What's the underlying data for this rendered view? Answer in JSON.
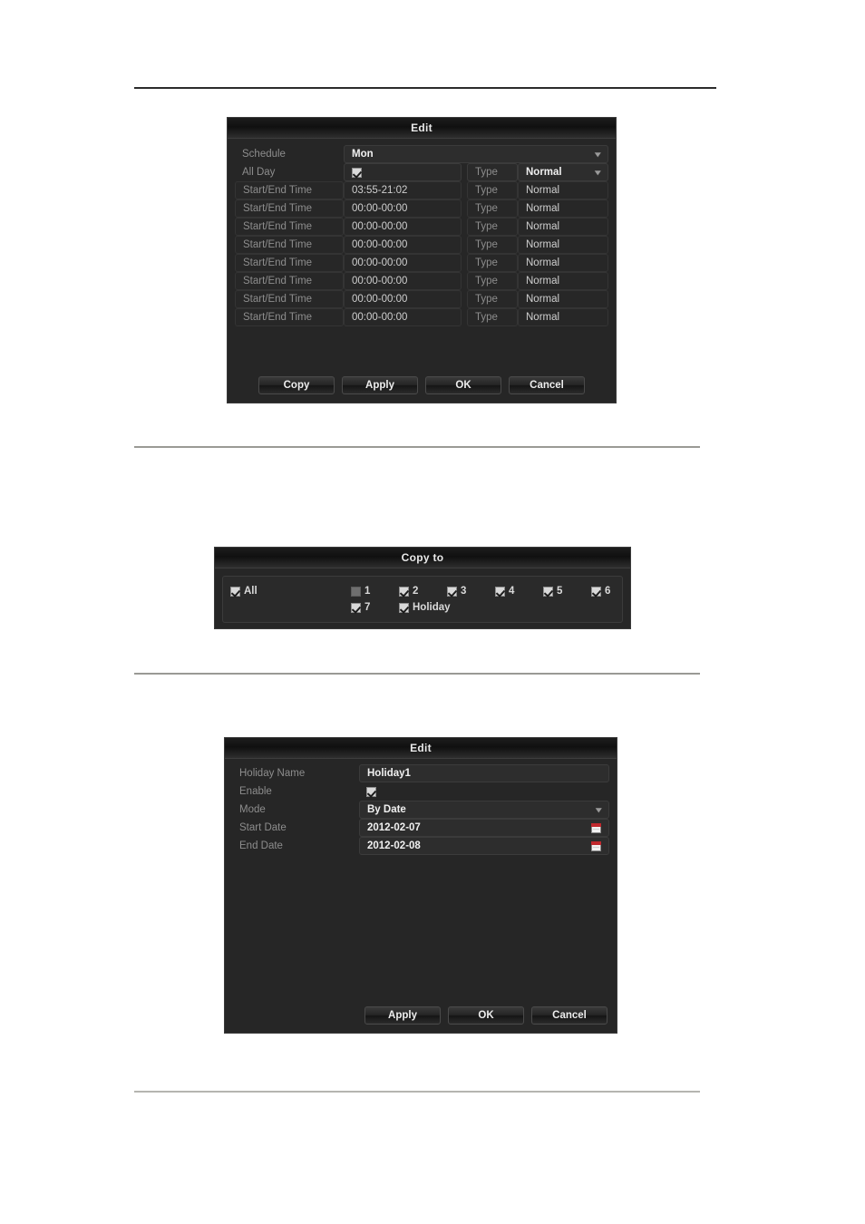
{
  "page": {
    "background": "#ffffff",
    "rule_color_dark": "#2b2b2b",
    "rule_color_light": "#9a9a95"
  },
  "schedule_dialog": {
    "title": "Edit",
    "schedule_label": "Schedule",
    "schedule_value": "Mon",
    "all_day_label": "All Day",
    "all_day_checked": true,
    "all_day_type_label": "Type",
    "all_day_type_value": "Normal",
    "rows": [
      {
        "label": "Start/End Time",
        "time": "03:55-21:02",
        "type_label": "Type",
        "type_value": "Normal"
      },
      {
        "label": "Start/End Time",
        "time": "00:00-00:00",
        "type_label": "Type",
        "type_value": "Normal"
      },
      {
        "label": "Start/End Time",
        "time": "00:00-00:00",
        "type_label": "Type",
        "type_value": "Normal"
      },
      {
        "label": "Start/End Time",
        "time": "00:00-00:00",
        "type_label": "Type",
        "type_value": "Normal"
      },
      {
        "label": "Start/End Time",
        "time": "00:00-00:00",
        "type_label": "Type",
        "type_value": "Normal"
      },
      {
        "label": "Start/End Time",
        "time": "00:00-00:00",
        "type_label": "Type",
        "type_value": "Normal"
      },
      {
        "label": "Start/End Time",
        "time": "00:00-00:00",
        "type_label": "Type",
        "type_value": "Normal"
      },
      {
        "label": "Start/End Time",
        "time": "00:00-00:00",
        "type_label": "Type",
        "type_value": "Normal"
      }
    ],
    "buttons": {
      "copy": "Copy",
      "apply": "Apply",
      "ok": "OK",
      "cancel": "Cancel"
    }
  },
  "copy_to_dialog": {
    "title": "Copy to",
    "all": {
      "label": "All",
      "checked": true,
      "disabled": false
    },
    "days": [
      {
        "label": "1",
        "checked": false,
        "disabled": true
      },
      {
        "label": "2",
        "checked": true,
        "disabled": false
      },
      {
        "label": "3",
        "checked": true,
        "disabled": false
      },
      {
        "label": "4",
        "checked": true,
        "disabled": false
      },
      {
        "label": "5",
        "checked": true,
        "disabled": false
      },
      {
        "label": "6",
        "checked": true,
        "disabled": false
      },
      {
        "label": "7",
        "checked": true,
        "disabled": false
      },
      {
        "label": "Holiday",
        "checked": true,
        "disabled": false
      }
    ]
  },
  "holiday_dialog": {
    "title": "Edit",
    "fields": {
      "holiday_name_label": "Holiday Name",
      "holiday_name_value": "Holiday1",
      "enable_label": "Enable",
      "enable_checked": true,
      "mode_label": "Mode",
      "mode_value": "By Date",
      "start_date_label": "Start Date",
      "start_date_value": "2012-02-07",
      "end_date_label": "End Date",
      "end_date_value": "2012-02-08"
    },
    "buttons": {
      "apply": "Apply",
      "ok": "OK",
      "cancel": "Cancel"
    }
  }
}
